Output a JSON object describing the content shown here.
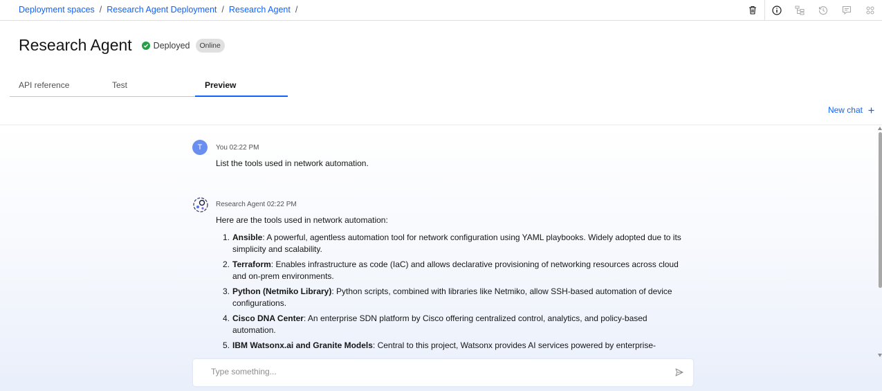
{
  "breadcrumb": [
    "Deployment spaces",
    "Research Agent Deployment",
    "Research Agent"
  ],
  "breadcrumb_sep": "/",
  "header": {
    "title": "Research Agent",
    "status": "Deployed",
    "badge": "Online"
  },
  "tabs": [
    "API reference",
    "Test",
    "Preview"
  ],
  "active_tab": "Preview",
  "new_chat_label": "New chat",
  "chat": {
    "user": {
      "initial": "T",
      "meta": "You 02:22 PM",
      "text": "List the tools used in network automation."
    },
    "agent": {
      "meta": "Research Agent 02:22 PM",
      "intro": "Here are the tools used in network automation:",
      "items": [
        {
          "num": "1.",
          "name": "Ansible",
          "desc": ": A powerful, agentless automation tool for network configuration using YAML playbooks. Widely adopted due to its simplicity and scalability."
        },
        {
          "num": "2.",
          "name": "Terraform",
          "desc": ": Enables infrastructure as code (IaC) and allows declarative provisioning of networking resources across cloud and on-prem environments."
        },
        {
          "num": "3.",
          "name": "Python (Netmiko Library)",
          "desc": ": Python scripts, combined with libraries like Netmiko, allow SSH-based automation of device configurations."
        },
        {
          "num": "4.",
          "name": "Cisco DNA Center",
          "desc": ": An enterprise SDN platform by Cisco offering centralized control, analytics, and policy-based automation."
        },
        {
          "num": "5.",
          "name": "IBM Watsonx.ai and Granite Models",
          "desc": ": Central to this project, Watsonx provides AI services powered by enterprise-"
        }
      ]
    }
  },
  "input": {
    "placeholder": "Type something..."
  },
  "colors": {
    "accent": "#0f62fe",
    "status_ok": "#24a148",
    "user_avatar": "#6a8ff0"
  },
  "icons": [
    "trash-icon",
    "info-icon",
    "flow-icon",
    "history-icon",
    "chat-icon",
    "apps-icon",
    "checkmark-icon",
    "add-icon",
    "send-icon",
    "agent-icon"
  ]
}
